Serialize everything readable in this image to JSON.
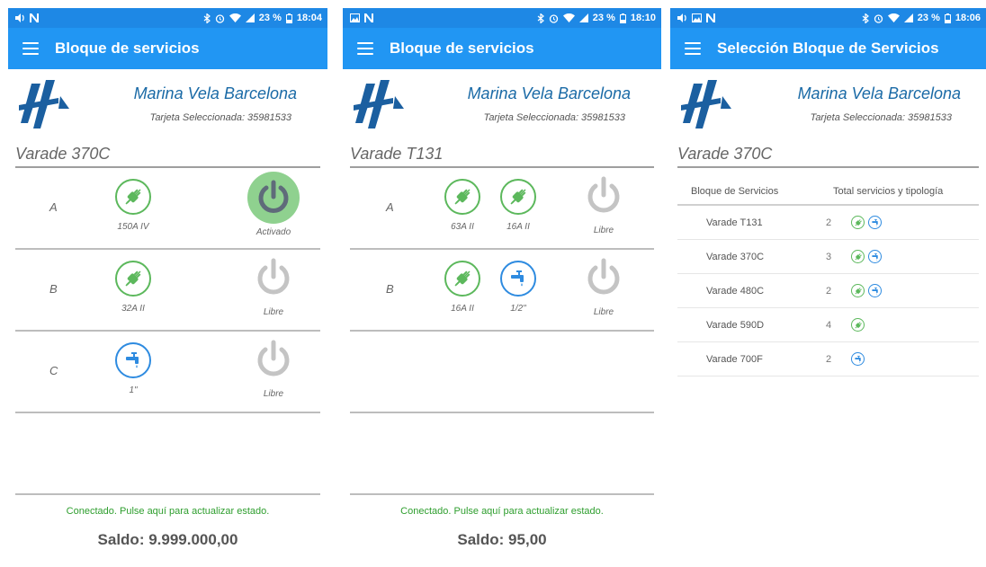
{
  "colors": {
    "appbar": "#2196f3",
    "statusbar": "#1e88e5",
    "electric": "#5cb85c",
    "water": "#2e8be0",
    "active_power": "#8fd18f",
    "inactive_power": "#c4c4c4",
    "connected_text": "#2e9e2e",
    "marina_text": "#1a6aa6"
  },
  "screens": [
    {
      "status": {
        "battery": "23 %",
        "time": "18:04",
        "left_icons": [
          "volume-icon",
          "n-icon"
        ]
      },
      "appbar_title": "Bloque de servicios",
      "marina": "Marina Vela Barcelona",
      "tarjeta": "Tarjeta Seleccionada: 35981533",
      "varade": "Varade 370C",
      "rows": [
        {
          "letter": "A",
          "services": [
            {
              "icon": "plug-icon",
              "label": "150A IV"
            }
          ],
          "power": {
            "label": "Activado",
            "state": "active"
          }
        },
        {
          "letter": "B",
          "services": [
            {
              "icon": "plug-icon",
              "label": "32A II"
            }
          ],
          "power": {
            "label": "Libre",
            "state": "inactive"
          }
        },
        {
          "letter": "C",
          "services": [
            {
              "icon": "water-tap-icon",
              "label": "1\""
            }
          ],
          "power": {
            "label": "Libre",
            "state": "inactive"
          }
        }
      ],
      "connected": "Conectado. Pulse aquí para actualizar estado.",
      "saldo": "Saldo: 9.999.000,00"
    },
    {
      "status": {
        "battery": "23 %",
        "time": "18:10",
        "left_icons": [
          "image-icon",
          "n-icon"
        ]
      },
      "appbar_title": "Bloque de servicios",
      "marina": "Marina Vela Barcelona",
      "tarjeta": "Tarjeta Seleccionada: 35981533",
      "varade": "Varade T131",
      "rows": [
        {
          "letter": "A",
          "services": [
            {
              "icon": "plug-icon",
              "label": "63A II"
            },
            {
              "icon": "plug-icon",
              "label": "16A II"
            }
          ],
          "power": {
            "label": "Libre",
            "state": "inactive"
          }
        },
        {
          "letter": "B",
          "services": [
            {
              "icon": "plug-icon",
              "label": "16A II"
            },
            {
              "icon": "water-tap-icon",
              "label": "1/2\""
            }
          ],
          "power": {
            "label": "Libre",
            "state": "inactive"
          }
        }
      ],
      "connected": "Conectado. Pulse aquí para actualizar estado.",
      "saldo": "Saldo: 95,00"
    },
    {
      "status": {
        "battery": "23 %",
        "time": "18:06",
        "left_icons": [
          "volume-icon",
          "image-icon",
          "n-icon"
        ]
      },
      "appbar_title": "Selección Bloque de Servicios",
      "marina": "Marina Vela Barcelona",
      "tarjeta": "Tarjeta Seleccionada: 35981533",
      "varade": "Varade 370C",
      "table": {
        "col1": "Bloque de Servicios",
        "col2": "Total servicios y tipología",
        "rows": [
          {
            "name": "Varade T131",
            "count": "2",
            "icons": [
              "plug-icon",
              "water-tap-icon"
            ]
          },
          {
            "name": "Varade 370C",
            "count": "3",
            "icons": [
              "plug-icon",
              "water-tap-icon"
            ]
          },
          {
            "name": "Varade 480C",
            "count": "2",
            "icons": [
              "plug-icon",
              "water-tap-icon"
            ]
          },
          {
            "name": "Varade 590D",
            "count": "4",
            "icons": [
              "plug-icon"
            ]
          },
          {
            "name": "Varade 700F",
            "count": "2",
            "icons": [
              "water-tap-icon"
            ]
          }
        ]
      }
    }
  ]
}
